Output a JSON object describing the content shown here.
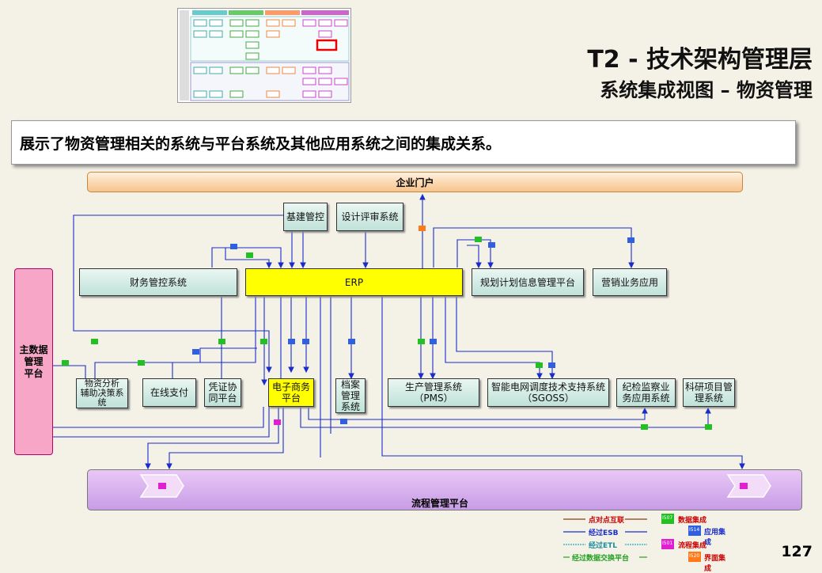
{
  "page": {
    "title_main": "T2 - 技术架构管理层",
    "title_sub": "系统集成视图 – 物资管理",
    "description": "展示了物资管理相关的系统与平台系统及其他应用系统之间的集成关系。",
    "page_number": "127"
  },
  "systems": {
    "portal": "企业门户",
    "infra": "基建管控",
    "design_review": "设计评审系统",
    "finance": "财务管控系统",
    "erp": "ERP",
    "planning": "规划计划信息管理平台",
    "marketing": "营销业务应用",
    "mdm": "主数据\n管理\n平台",
    "material_analysis": "物资分析\n辅助决策系\n统",
    "online_pay": "在线支付",
    "voucher": "凭证协\n同平台",
    "ecommerce": "电子商务\n平台",
    "archive": "档案\n管理\n系统",
    "pms": "生产管理系统\n（PMS）",
    "sgoss": "智能电网调度技术支持系统\n（SGOSS）",
    "discipline": "纪检监察业\n务应用系统",
    "research": "科研项目管\n理系统",
    "flow_platform": "流程管理平台"
  },
  "legend": {
    "p2p": "点对点互联",
    "esb": "经过ESB",
    "etl": "经过ETL",
    "dx": "经过数据交换平台",
    "data_integration": "数据集成",
    "app_integration": "应用集成",
    "process_integration": "流程集成",
    "ui_integration": "界面集成",
    "code_data": "I507",
    "code_app": "I514",
    "code_process": "I501",
    "code_ui": "I520"
  },
  "colors": {
    "esb_line": "#1a2ccc",
    "data_badge": "#22c022",
    "app_badge": "#3060e0",
    "process_badge": "#e020d0",
    "ui_badge": "#ff7a1a",
    "p2p_line": "#8b3a1a"
  }
}
